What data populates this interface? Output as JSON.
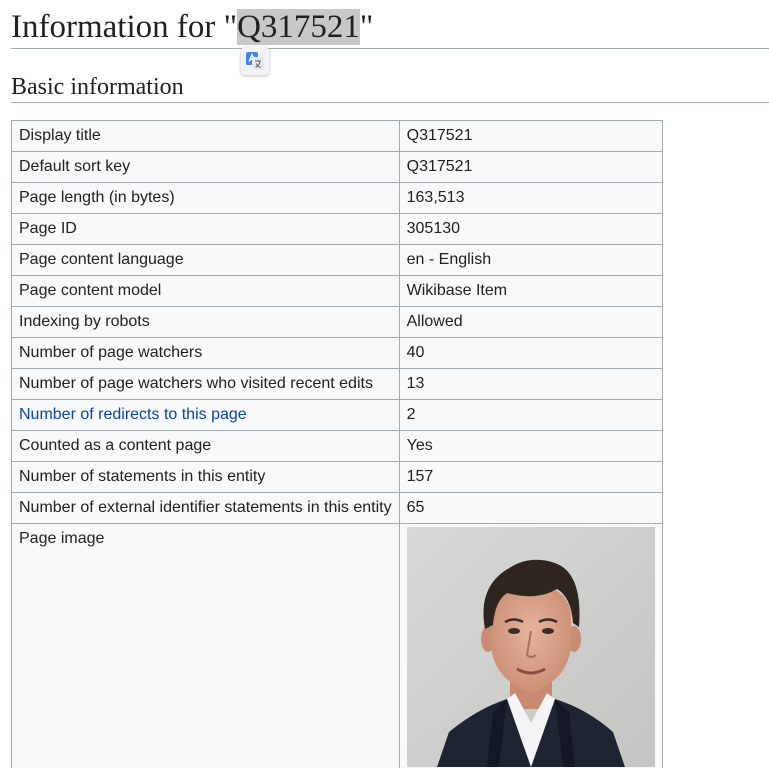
{
  "header": {
    "title_prefix": "Information for \"",
    "title_id": "Q317521",
    "title_suffix": "\""
  },
  "section": {
    "heading": "Basic information"
  },
  "info_rows": [
    {
      "key": "Display title",
      "value": "Q317521"
    },
    {
      "key": "Default sort key",
      "value": "Q317521"
    },
    {
      "key": "Page length (in bytes)",
      "value": "163,513"
    },
    {
      "key": "Page ID",
      "value": "305130"
    },
    {
      "key": "Page content language",
      "value": "en - English"
    },
    {
      "key": "Page content model",
      "value": "Wikibase Item"
    },
    {
      "key": "Indexing by robots",
      "value": "Allowed"
    },
    {
      "key": "Number of page watchers",
      "value": "40"
    },
    {
      "key": "Number of page watchers who visited recent edits",
      "value": "13"
    },
    {
      "key": "Number of redirects to this page",
      "value": "2"
    },
    {
      "key": "Counted as a content page",
      "value": "Yes"
    },
    {
      "key": "Number of statements in this entity",
      "value": "157"
    },
    {
      "key": "Number of external identifier statements in this entity",
      "value": "65"
    }
  ],
  "page_image": {
    "key": "Page image"
  },
  "colors": {
    "link": "#0645ad",
    "table_bg": "#f8f9fa",
    "border": "#a2a9b1",
    "highlight": "#c8c8c8"
  },
  "icons": {
    "translate": "google-translate-icon"
  }
}
